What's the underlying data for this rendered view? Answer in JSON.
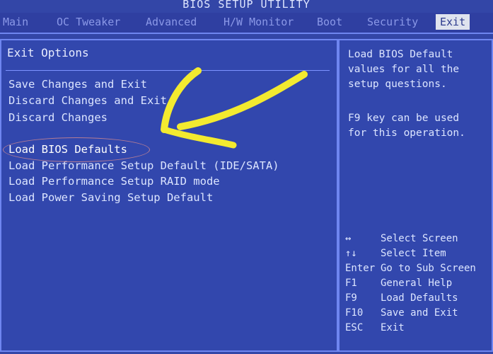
{
  "header": {
    "title": "BIOS SETUP UTILITY",
    "tabs": [
      {
        "label": "Main"
      },
      {
        "label": "OC Tweaker"
      },
      {
        "label": "Advanced"
      },
      {
        "label": "H/W Monitor"
      },
      {
        "label": "Boot"
      },
      {
        "label": "Security"
      },
      {
        "label": "Exit"
      }
    ]
  },
  "left": {
    "section_title": "Exit Options",
    "options": [
      "Save Changes and Exit",
      "Discard Changes and Exit",
      "Discard Changes",
      "Load BIOS Defaults",
      "Load Performance Setup Default (IDE/SATA)",
      "Load Performance Setup RAID mode",
      "Load Power Saving Setup Default"
    ]
  },
  "right": {
    "help1": "Load BIOS Default\nvalues for all the\nsetup questions.",
    "help2": "F9 key can be used\nfor this operation.",
    "keys": [
      {
        "key": "↔",
        "desc": "Select Screen"
      },
      {
        "key": "↑↓",
        "desc": "Select Item"
      },
      {
        "key": "Enter",
        "desc": "Go to Sub Screen"
      },
      {
        "key": "F1",
        "desc": "General Help"
      },
      {
        "key": "F9",
        "desc": "Load Defaults"
      },
      {
        "key": "F10",
        "desc": "Save and Exit"
      },
      {
        "key": "ESC",
        "desc": "Exit"
      }
    ]
  },
  "colors": {
    "background": "#3346a7",
    "text": "#dce5ff",
    "border": "#6f86f0",
    "active_tab_bg": "#dfe3ee",
    "annotation": "#f3ea2f",
    "ellipse": "#d78b8f"
  }
}
